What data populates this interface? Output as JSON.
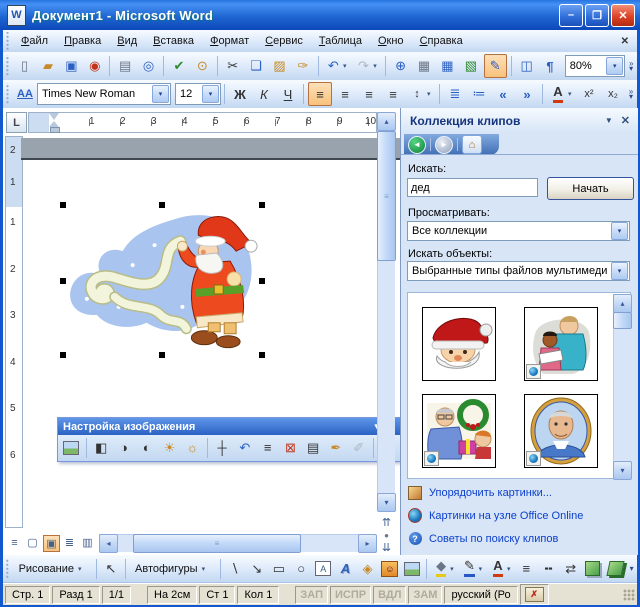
{
  "window": {
    "title": "Документ1 - Microsoft Word"
  },
  "colors": {
    "titlebar_blue": "#1E64D0",
    "active_toggle": "#F8C27C",
    "link_blue": "#0B3FCC",
    "pane_bg": "#D7E5F7",
    "selection_gray_strip": "#99A3AD"
  },
  "menu": {
    "items": [
      {
        "label": "Файл"
      },
      {
        "label": "Правка"
      },
      {
        "label": "Вид"
      },
      {
        "label": "Вставка"
      },
      {
        "label": "Формат"
      },
      {
        "label": "Сервис"
      },
      {
        "label": "Таблица"
      },
      {
        "label": "Окно"
      },
      {
        "label": "Справка"
      }
    ]
  },
  "standard": {
    "zoom": "80%"
  },
  "formatting": {
    "font": "Times New Roman",
    "size": "12"
  },
  "ruler": {
    "h": [
      "1",
      "2",
      "3",
      "4",
      "5",
      "6",
      "7",
      "8",
      "9",
      "10"
    ],
    "v_top": [
      "2",
      "1"
    ],
    "v": [
      "1",
      "2",
      "3",
      "4",
      "5",
      "6"
    ]
  },
  "picture_toolbar": {
    "title": "Настройка изображения"
  },
  "task_pane": {
    "title": "Коллекция клипов",
    "search_label": "Искать:",
    "search_value": "дед",
    "search_button": "Начать",
    "browse_label": "Просматривать:",
    "collection_value": "Все коллекции",
    "objects_label": "Искать объекты:",
    "objects_value": "Выбранные типы файлов мультимеди",
    "links": [
      {
        "label": "Упорядочить картинки..."
      },
      {
        "label": "Картинки на узле Office Online"
      },
      {
        "label": "Советы по поиску клипов"
      }
    ]
  },
  "drawing_toolbar": {
    "draw_menu": "Рисование",
    "autoshapes": "Автофигуры"
  },
  "status": {
    "page": "Стр. 1",
    "section": "Разд 1",
    "position": "1/1",
    "at": "На 2см",
    "line": "Ст 1",
    "col": "Кол 1",
    "modes": [
      "ЗАП",
      "ИСПР",
      "ВДЛ",
      "ЗАМ"
    ],
    "lang": "русский (Ро"
  },
  "icons": {
    "word": "W",
    "min": "–",
    "max": "❐",
    "close": "✕",
    "menuclose": "✕",
    "new": "▯",
    "open": "▰",
    "save": "▣",
    "permission": "◉",
    "print": "▤",
    "preview": "◎",
    "spelling": "✔",
    "research": "⊙",
    "cut": "✂",
    "copy": "❏",
    "paste": "▨",
    "painter": "✑",
    "undo": "↶",
    "redo": "↷",
    "dd": "▾",
    "hyperlink": "⊕",
    "tablesborders": "▦",
    "table": "▦",
    "excel": "▧",
    "drawingtoggle": "✎",
    "docmap": "◫",
    "para": "¶",
    "chevron": "»",
    "styles": "АА",
    "bold": "Ж",
    "italic": "К",
    "underline": "Ч",
    "alignleft": "≡",
    "aligncenter": "≡",
    "alignright": "≡",
    "justify": "≡",
    "spacing": "↕",
    "numbered": "≣",
    "bulleted": "≔",
    "outdent": "«",
    "indent": "»",
    "fontcolor": "А",
    "sup": "x²",
    "sub": "x₂",
    "tabsel": "L",
    "up": "▴",
    "down": "▾",
    "left": "◂",
    "right": "▸",
    "browseup": "⇈",
    "browseobj": "●",
    "browsedown": "⇊",
    "vnormal": "≡",
    "vweb": "▢",
    "vprint": "▣",
    "voutline": "≣",
    "vreading": "▥",
    "back": "◄",
    "forward": "►",
    "home": "⌂",
    "panemenu": "▼",
    "paneclose": "✕",
    "ptcolor": "◧",
    "ptcontrastup": "◑",
    "ptcontrastdn": "◐",
    "ptbrightup": "☀",
    "ptbrightdn": "☼",
    "ptcrop": "┼",
    "ptrotate": "↶",
    "ptline": "≡",
    "ptcompress": "⊠",
    "ptwrap": "▤",
    "ptformat": "✒",
    "pttransparent": "✐",
    "ptreset": "↩",
    "pttoolmenu": "▼",
    "ptclose": "✕",
    "drselect": "↖",
    "drline": "∖",
    "drarrow": "↘",
    "drrect": "▭",
    "droval": "○",
    "drtextbox": "А",
    "drwordart": "А",
    "drdiagram": "◈",
    "drclip": "☺",
    "drfill": "◆",
    "drlinecolor": "✎",
    "drfontcolor": "А",
    "drlinestyle": "≡",
    "drdash": "╍",
    "drarrowstyle": "⇄",
    "tips": "?",
    "spellmark": "✗"
  }
}
